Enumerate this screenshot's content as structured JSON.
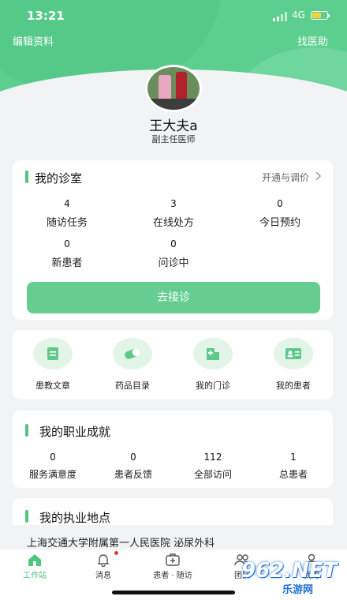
{
  "status": {
    "time": "13:21",
    "network": "4G"
  },
  "header": {
    "left_link": "编辑资料",
    "right_link": "找医助"
  },
  "profile": {
    "name": "王大夫a",
    "title": "副主任医师"
  },
  "clinic": {
    "title": "我的诊室",
    "action": "开通与调价",
    "stats": [
      {
        "value": "4",
        "label": "随访任务"
      },
      {
        "value": "3",
        "label": "在线处方"
      },
      {
        "value": "0",
        "label": "今日预约"
      },
      {
        "value": "0",
        "label": "新患者"
      },
      {
        "value": "0",
        "label": "问诊中"
      }
    ],
    "button": "去接诊"
  },
  "quick_links": [
    {
      "label": "患教文章",
      "icon": "article-icon"
    },
    {
      "label": "药品目录",
      "icon": "pill-icon"
    },
    {
      "label": "我的门诊",
      "icon": "clinic-icon"
    },
    {
      "label": "我的患者",
      "icon": "patient-card-icon"
    }
  ],
  "achievements": {
    "title": "我的职业成就",
    "stats": [
      {
        "value": "0",
        "label": "服务满意度"
      },
      {
        "value": "0",
        "label": "患者反馈"
      },
      {
        "value": "112",
        "label": "全部访问"
      },
      {
        "value": "1",
        "label": "总患者"
      }
    ]
  },
  "practice": {
    "title": "我的执业地点",
    "location": "上海交通大学附属第一人民医院 泌尿外科"
  },
  "tabs": [
    {
      "label": "工作站",
      "icon": "home-icon"
    },
    {
      "label": "消息",
      "icon": "bell-icon"
    },
    {
      "label": "患者 · 随访",
      "icon": "medical-box-icon"
    },
    {
      "label": "团队",
      "icon": "team-icon"
    },
    {
      "label": "我的",
      "icon": "user-icon"
    }
  ],
  "watermark": {
    "main": "962.NET",
    "sub": "乐游网"
  },
  "colors": {
    "brand_green": "#5ccf8f",
    "accent_green": "#4fc57f",
    "badge_red": "#e53935"
  }
}
